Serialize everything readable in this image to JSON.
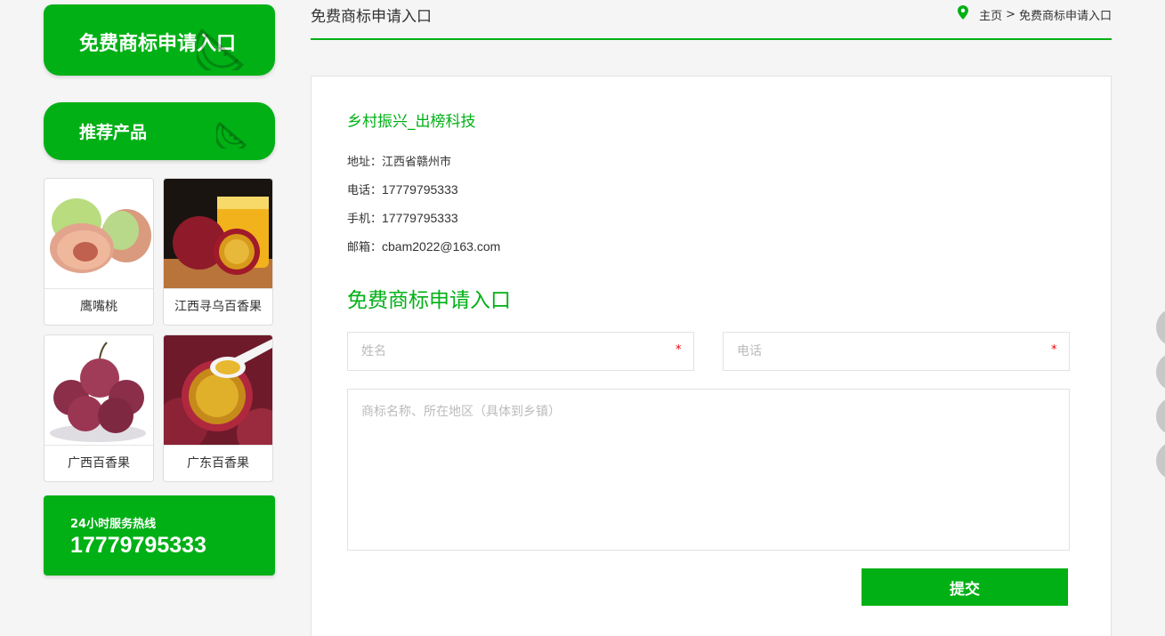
{
  "sidebar": {
    "title1": "免费商标申请入口",
    "title2": "推荐产品",
    "products": [
      {
        "name": "鹰嘴桃"
      },
      {
        "name": "江西寻乌百香果"
      },
      {
        "name": "广西百香果"
      },
      {
        "name": "广东百香果"
      }
    ],
    "hotline": {
      "label": "24小时服务热线",
      "number": "17779795333"
    }
  },
  "header": {
    "title": "免费商标申请入口",
    "breadcrumb": {
      "home": "主页",
      "separator": ">",
      "current": "免费商标申请入口"
    }
  },
  "contact": {
    "company": "乡村振兴_出榜科技",
    "address_label": "地址：",
    "address": "江西省赣州市",
    "phone_label": "电话：",
    "phone": "17779795333",
    "mobile_label": "手机：",
    "mobile": "17779795333",
    "email_label": "邮箱：",
    "email": "cbam2022@163.com"
  },
  "form": {
    "title": "免费商标申请入口",
    "name_placeholder": "姓名",
    "phone_placeholder": "电话",
    "required_mark": "*",
    "message_placeholder": "商标名称、所在地区（具体到乡镇）",
    "submit_label": "提交"
  },
  "colors": {
    "accent": "#00b015"
  }
}
